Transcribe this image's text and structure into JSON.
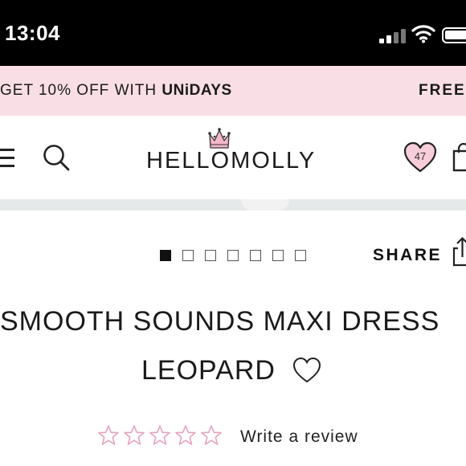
{
  "status_bar": {
    "time": "13:04",
    "icons": [
      "cellular-signal-icon",
      "wifi-icon",
      "battery-icon"
    ]
  },
  "promo": {
    "left_text": "GET 10% OFF WITH ",
    "left_brand": "UNiDAYS",
    "right_text": "FREE"
  },
  "header": {
    "logo_text": "HELLOMOLLY",
    "wishlist_count": "47",
    "icons": [
      "menu-icon",
      "search-icon",
      "crown-icon",
      "heart-icon",
      "bag-icon"
    ]
  },
  "carousel": {
    "total_images": 7,
    "active_index": 0
  },
  "share": {
    "label": "SHARE"
  },
  "product": {
    "title_line1": "SMOOTH SOUNDS MAXI DRESS",
    "title_line2": "LEOPARD"
  },
  "rating": {
    "stars_filled": 0,
    "stars_total": 5,
    "review_link": "Write a review"
  },
  "colors": {
    "promo_bg": "#f9dfe5",
    "accent_pink": "#e9a3b8",
    "text": "#111111"
  }
}
